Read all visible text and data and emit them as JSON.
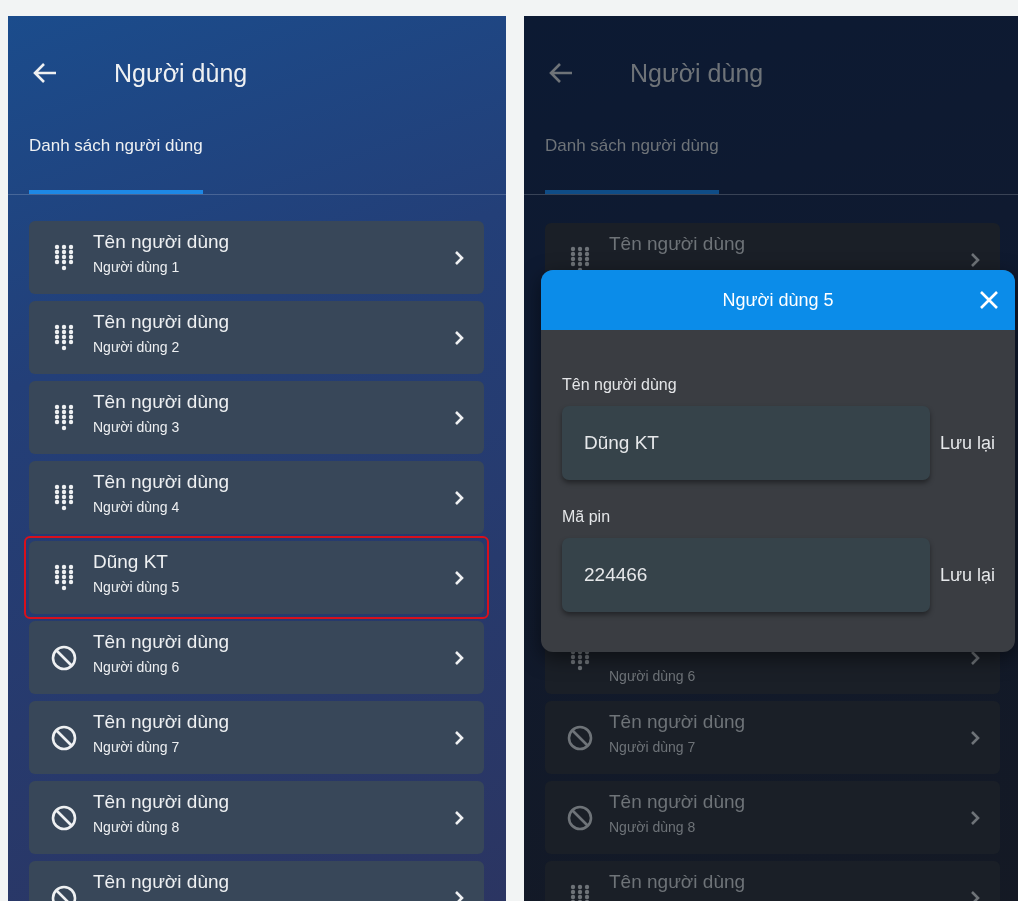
{
  "screens": [
    {
      "dimmed": false,
      "header": {
        "title": "Người dùng"
      },
      "tabs": [
        {
          "label": "Danh sách người dùng",
          "selected": true
        }
      ],
      "users": [
        {
          "kind": "keypad",
          "name": "Tên người dùng",
          "subtitle": "Người dùng 1",
          "highlighted": false
        },
        {
          "kind": "keypad",
          "name": "Tên người dùng",
          "subtitle": "Người dùng 2",
          "highlighted": false
        },
        {
          "kind": "keypad",
          "name": "Tên người dùng",
          "subtitle": "Người dùng 3",
          "highlighted": false
        },
        {
          "kind": "keypad",
          "name": "Tên người dùng",
          "subtitle": "Người dùng 4",
          "highlighted": false
        },
        {
          "kind": "keypad",
          "name": "Dũng KT",
          "subtitle": "Người dùng 5",
          "highlighted": true
        },
        {
          "kind": "ban",
          "name": "Tên người dùng",
          "subtitle": "Người dùng 6",
          "highlighted": false
        },
        {
          "kind": "ban",
          "name": "Tên người dùng",
          "subtitle": "Người dùng 7",
          "highlighted": false
        },
        {
          "kind": "ban",
          "name": "Tên người dùng",
          "subtitle": "Người dùng 8",
          "highlighted": false
        },
        {
          "kind": "ban",
          "name": "Tên người dùng",
          "highlighted": false
        }
      ]
    },
    {
      "dimmed": true,
      "header": {
        "title": "Người dùng"
      },
      "tabs": [
        {
          "label": "Danh sách người dùng",
          "selected": true
        }
      ],
      "users": [
        {
          "kind": "keypad",
          "name": "Tên người dùng",
          "highlighted": false
        },
        {
          "kind": "keypad",
          "subtitle": "Người dùng 6",
          "highlighted": false
        },
        {
          "kind": "ban",
          "name": "Tên người dùng",
          "subtitle": "Người dùng 7",
          "highlighted": false
        },
        {
          "kind": "ban",
          "name": "Tên người dùng",
          "subtitle": "Người dùng 8",
          "highlighted": false
        },
        {
          "kind": "keypad",
          "name": "Tên người dùng",
          "highlighted": false
        }
      ],
      "dialog": {
        "title": "Người dùng 5",
        "fields": [
          {
            "label": "Tên người dùng",
            "value": "Dũng KT",
            "button": "Lưu lại"
          },
          {
            "label": "Mã pin",
            "value": "224466",
            "button": "Lưu lại"
          }
        ]
      }
    }
  ]
}
